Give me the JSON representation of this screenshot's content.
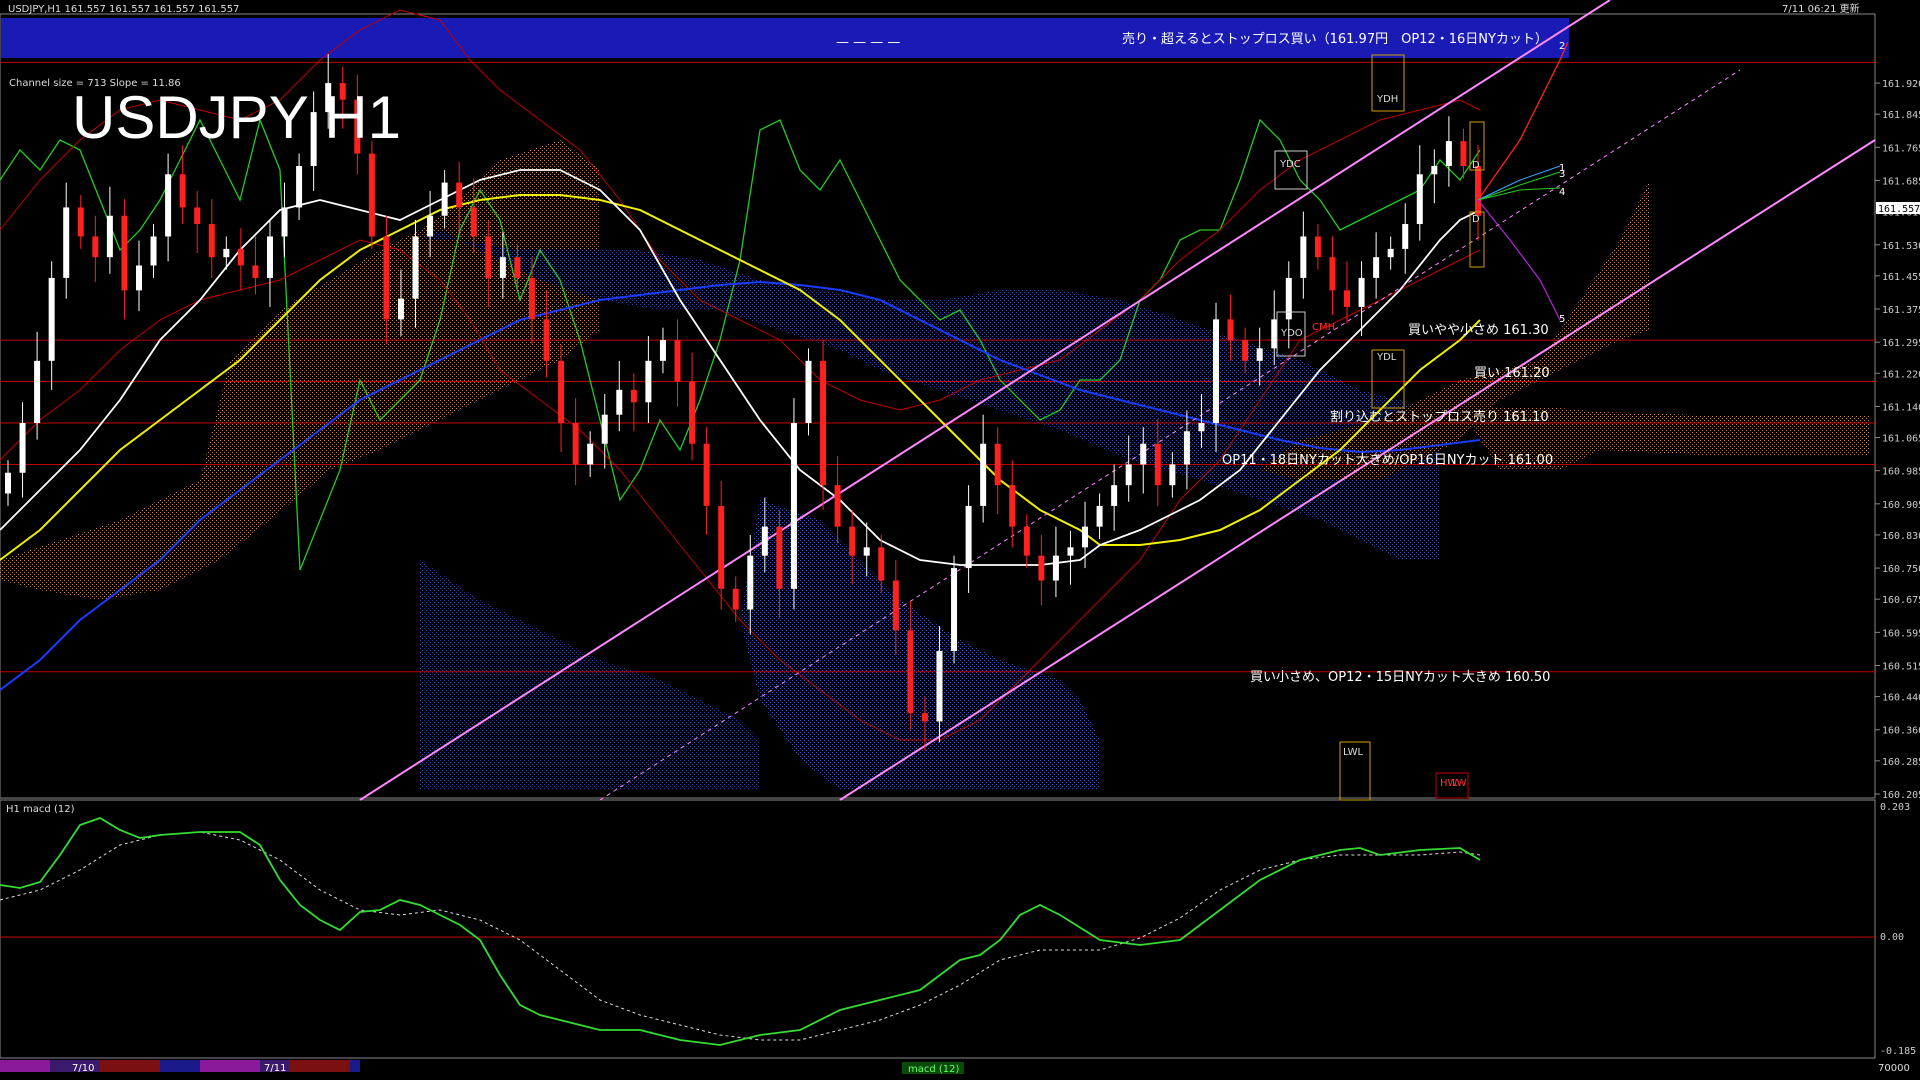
{
  "header": {
    "symbol_line": "USDJPY,H1  161.557 161.557 161.557 161.557",
    "datetime": "7/11 06:21 更新",
    "big_title": "USDJPY H1",
    "channel_info": "Channel size = 713 Slope = 11.86"
  },
  "banner": {
    "text": "売り・超えるとストップロス買い（161.97円　OP12・16日NYカット）",
    "dashes": "— — — —"
  },
  "annotations": [
    {
      "key": "buy_small_161_30",
      "text": "買いやや小さめ 161.30"
    },
    {
      "key": "buy_161_20",
      "text": "買い 161.20"
    },
    {
      "key": "sell_161_10",
      "text": "割り込むとストップロス売り 161.10"
    },
    {
      "key": "op_161_00",
      "text": "OP11・18日NYカット大きめ/OP16日NYカット 161.00"
    },
    {
      "key": "buy_160_50",
      "text": "買い小さめ、OP12・15日NYカット大きめ 160.50"
    }
  ],
  "markers": {
    "ydc": "YDC",
    "ydo": "YDO",
    "ydh": "YDH",
    "ydl": "YDL",
    "lwl": "LWL",
    "hw": "HW",
    "lw": "LW",
    "cmh": "CMH",
    "d": "D",
    "r": "R"
  },
  "wave_labels": [
    "1",
    "2",
    "3",
    "4",
    "5"
  ],
  "price_axis": {
    "ticks": [
      "161.920",
      "161.845",
      "161.765",
      "161.685",
      "161.610",
      "161.530",
      "161.455",
      "161.375",
      "161.295",
      "161.220",
      "161.140",
      "161.065",
      "160.985",
      "160.905",
      "160.830",
      "160.750",
      "160.675",
      "160.595",
      "160.515",
      "160.440",
      "160.360",
      "160.285",
      "160.205"
    ],
    "current_price": "161.557"
  },
  "macd": {
    "label": "H1  macd (12)",
    "axis_ticks": [
      "0.203",
      "0.00",
      "-0.185"
    ]
  },
  "time_axis": {
    "labels": [
      "7/10",
      "7/11"
    ],
    "bottom_right": "70000",
    "tab": "macd (12)"
  },
  "colors": {
    "banner": "#1a1ab4",
    "bull_candle": "#ffffff",
    "bear_candle": "#ff2020",
    "sma_white": "#ffffff",
    "sma_yellow": "#f0f000",
    "sma_blue": "#1a3cff",
    "ichimoku_green": "#22cc22",
    "channel_pink": "#ff88ff",
    "level_red": "#c00000",
    "macd_green": "#33dd33",
    "macd_pink": "#ff88aa"
  },
  "chart_data": {
    "type": "candlestick",
    "title": "USDJPY H1",
    "ylim": [
      160.205,
      161.995
    ],
    "horizontal_levels": [
      161.97,
      161.3,
      161.2,
      161.1,
      161.0,
      160.5
    ],
    "ohlc_close_sequence": [
      160.98,
      161.1,
      161.25,
      161.45,
      161.62,
      161.55,
      161.5,
      161.6,
      161.42,
      161.48,
      161.55,
      161.7,
      161.62,
      161.58,
      161.5,
      161.52,
      161.48,
      161.45,
      161.55,
      161.62,
      161.72,
      161.85,
      161.92,
      161.88,
      161.75,
      161.55,
      161.35,
      161.4,
      161.55,
      161.6,
      161.68,
      161.62,
      161.55,
      161.45,
      161.5,
      161.45,
      161.35,
      161.25,
      161.1,
      161.0,
      161.05,
      161.12,
      161.18,
      161.15,
      161.25,
      161.3,
      161.2,
      161.05,
      160.9,
      160.7,
      160.65,
      160.78,
      160.85,
      160.7,
      161.1,
      161.25,
      160.95,
      160.85,
      160.78,
      160.8,
      160.72,
      160.6,
      160.4,
      160.38,
      160.55,
      160.75,
      160.9,
      161.05,
      160.95,
      160.85,
      160.78,
      160.72,
      160.78,
      160.8,
      160.85,
      160.9,
      160.95,
      161.0,
      161.05,
      160.95,
      161.0,
      161.08,
      161.1,
      161.35,
      161.3,
      161.25,
      161.28,
      161.35,
      161.45,
      161.55,
      161.5,
      161.42,
      161.38,
      161.45,
      161.5,
      161.52,
      161.58,
      161.7,
      161.72,
      161.78,
      161.72,
      161.6
    ]
  }
}
